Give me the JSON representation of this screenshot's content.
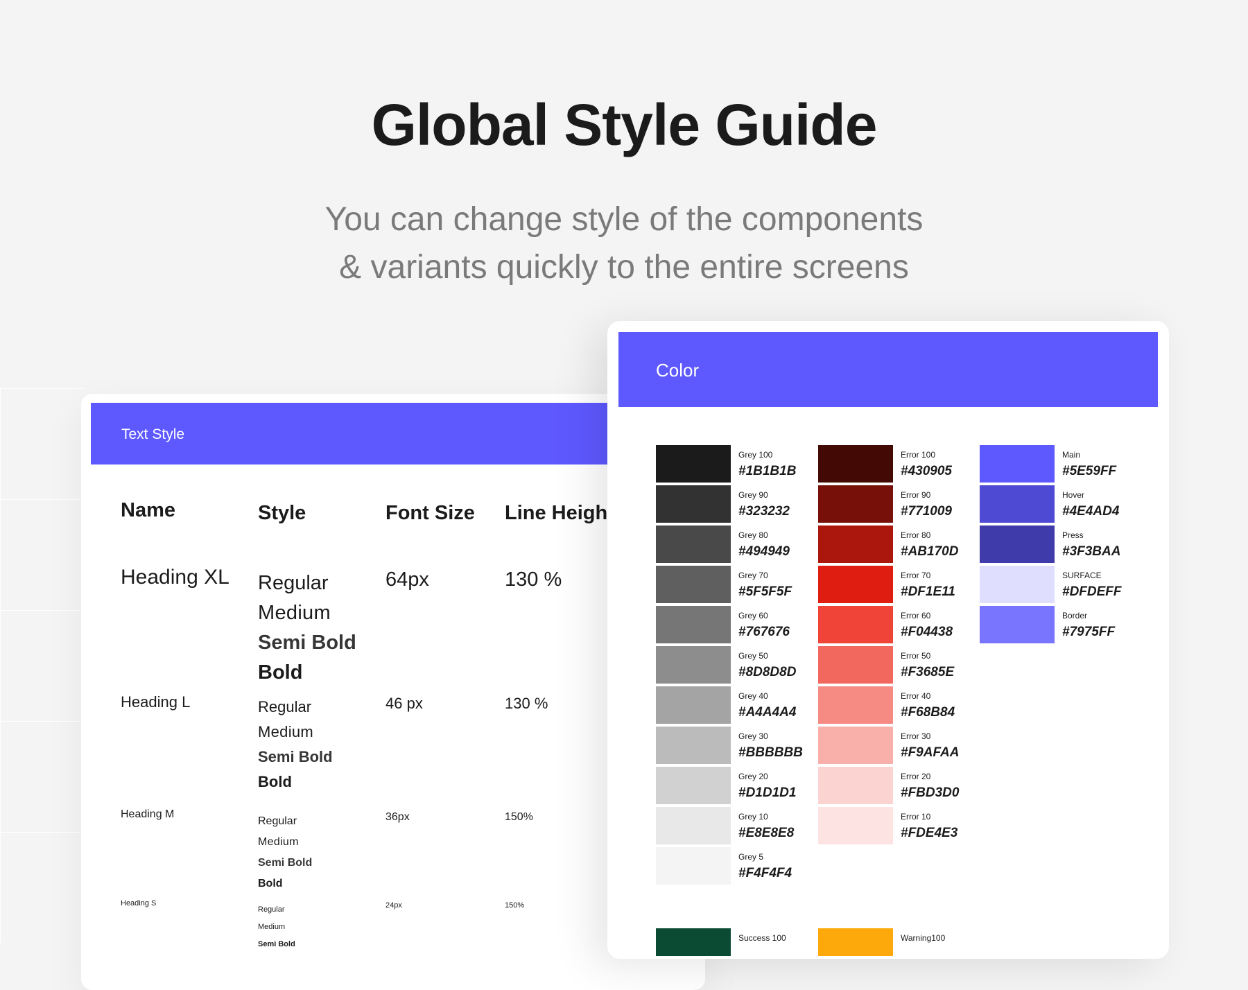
{
  "hero": {
    "title": "Global Style Guide",
    "subtitle_line1": "You can change style of the components",
    "subtitle_line2": "& variants quickly to the entire screens"
  },
  "text_style": {
    "header": "Text Style",
    "columns": [
      "Name",
      "Style",
      "Font Size",
      "Line Height"
    ],
    "rows": [
      {
        "name": "Heading XL",
        "styles": [
          "Regular",
          "Medium",
          "Semi Bold",
          "Bold"
        ],
        "size": "64px",
        "line_height": "130 %"
      },
      {
        "name": "Heading L",
        "styles": [
          "Regular",
          "Medium",
          "Semi Bold",
          "Bold"
        ],
        "size": "46 px",
        "line_height": "130 %"
      },
      {
        "name": "Heading M",
        "styles": [
          "Regular",
          "Medium",
          "Semi Bold",
          "Bold"
        ],
        "size": "36px",
        "line_height": "150%"
      },
      {
        "name": "Heading S",
        "styles": [
          "Regular",
          "Medium",
          "Semi Bold"
        ],
        "size": "24px",
        "line_height": "150%"
      }
    ]
  },
  "color": {
    "header": "Color",
    "grey": [
      {
        "name": "Grey 100",
        "hex": "#1B1B1B",
        "color": "#1B1B1B"
      },
      {
        "name": "Grey 90",
        "hex": "#323232",
        "color": "#323232"
      },
      {
        "name": "Grey 80",
        "hex": "#494949",
        "color": "#494949"
      },
      {
        "name": "Grey 70",
        "hex": "#5F5F5F",
        "color": "#5F5F5F"
      },
      {
        "name": "Grey 60",
        "hex": "#767676",
        "color": "#767676"
      },
      {
        "name": "Grey 50",
        "hex": "#8D8D8D",
        "color": "#8D8D8D"
      },
      {
        "name": "Grey 40",
        "hex": "#A4A4A4",
        "color": "#A4A4A4"
      },
      {
        "name": "Grey 30",
        "hex": "#BBBBBB",
        "color": "#BBBBBB"
      },
      {
        "name": "Grey 20",
        "hex": "#D1D1D1",
        "color": "#D1D1D1"
      },
      {
        "name": "Grey 10",
        "hex": "#E8E8E8",
        "color": "#E8E8E8"
      },
      {
        "name": "Grey 5",
        "hex": "#F4F4F4",
        "color": "#F4F4F4"
      }
    ],
    "error": [
      {
        "name": "Error 100",
        "hex": "#430905",
        "color": "#430905"
      },
      {
        "name": "Error 90",
        "hex": "#771009",
        "color": "#771009"
      },
      {
        "name": "Error 80",
        "hex": "#AB170D",
        "color": "#AB170D"
      },
      {
        "name": "Error 70",
        "hex": "#DF1E11",
        "color": "#DF1E11"
      },
      {
        "name": "Error 60",
        "hex": "#F04438",
        "color": "#F04438"
      },
      {
        "name": "Error 50",
        "hex": "#F3685E",
        "color": "#F3685E"
      },
      {
        "name": "Error 40",
        "hex": "#F68B84",
        "color": "#F68B84"
      },
      {
        "name": "Error 30",
        "hex": "#F9AFAA",
        "color": "#F9AFAA"
      },
      {
        "name": "Error 20",
        "hex": "#FBD3D0",
        "color": "#FBD3D0"
      },
      {
        "name": "Error 10",
        "hex": "#FDE4E3",
        "color": "#FDE4E3"
      }
    ],
    "primary": [
      {
        "name": "Main",
        "hex": "#5E59FF",
        "color": "#5E59FF"
      },
      {
        "name": "Hover",
        "hex": "#4E4AD4",
        "color": "#4E4AD4"
      },
      {
        "name": "Press",
        "hex": "#3F3BAA",
        "color": "#3F3BAA"
      },
      {
        "name": "SURFACE",
        "hex": "#DFDEFF",
        "color": "#DFDEFF"
      },
      {
        "name": "Border",
        "hex": "#7975FF",
        "color": "#7975FF"
      }
    ],
    "bottom": [
      {
        "name": "Success 100",
        "color": "#0B4A33"
      },
      {
        "name": "Warning100",
        "color": "#FDA90B"
      }
    ]
  },
  "colors": {
    "accent": "#5E59FF",
    "background": "#F4F4F4"
  }
}
